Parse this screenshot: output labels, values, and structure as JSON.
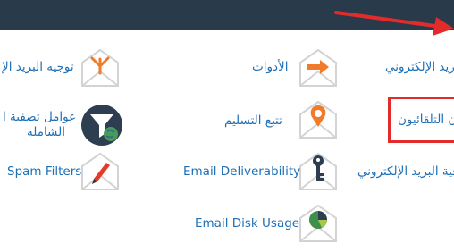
{
  "header": {
    "background": "#293a4a"
  },
  "annotation": {
    "arrow_color": "#e22b2b",
    "highlight_color": "#e22b2b"
  },
  "items": [
    {
      "label": "توجيه البريد الإ",
      "icon": "fork-arrow-envelope-icon"
    },
    {
      "label": "الأدوات",
      "icon": "arrow-envelope-icon"
    },
    {
      "label": "ريد الإلكتروني",
      "icon": ""
    },
    {
      "label": "عوامل تصفية ا",
      "label2": "الشاملة",
      "icon": "funnel-globe-icon"
    },
    {
      "label": "تتبع التسليم",
      "icon": "pin-envelope-icon"
    },
    {
      "label": "ن التلقائيون",
      "icon": ""
    },
    {
      "label": "Spam Filters",
      "icon": "pen-envelope-icon"
    },
    {
      "label": "Email Deliverability",
      "icon": "key-envelope-icon"
    },
    {
      "label": "فية البريد الإلكتروني",
      "icon": ""
    },
    {
      "label": "Email Disk Usage",
      "icon": "pie-envelope-icon"
    }
  ]
}
